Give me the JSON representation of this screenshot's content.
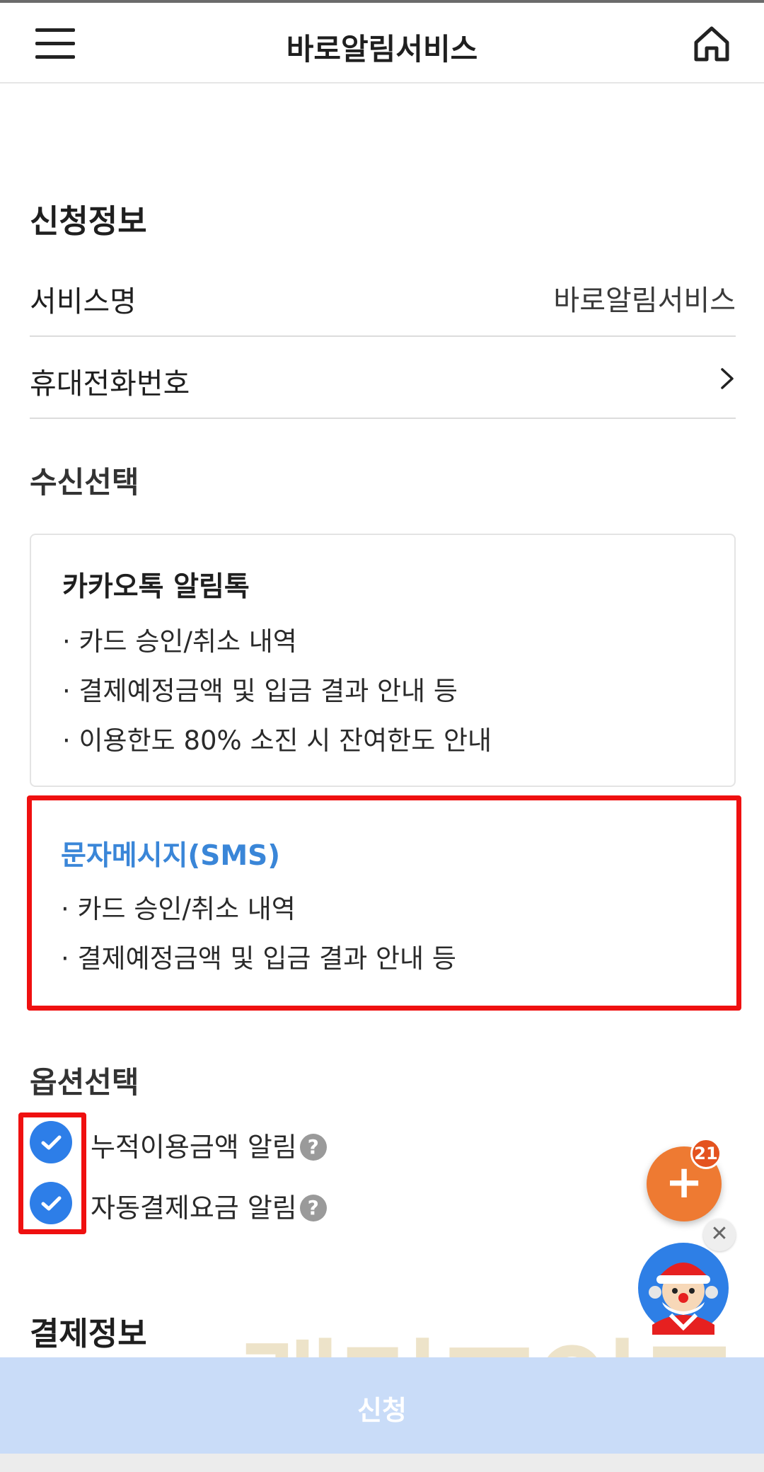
{
  "header": {
    "title": "바로알림서비스"
  },
  "application_info": {
    "section_title": "신청정보",
    "service_name_label": "서비스명",
    "service_name_value": "바로알림서비스",
    "phone_label": "휴대전화번호"
  },
  "reception": {
    "section_title": "수신선택",
    "kakao": {
      "title": "카카오톡 알림톡",
      "items": [
        "· 카드 승인/취소 내역",
        "· 결제예정금액 및 입금 결과 안내 등",
        "· 이용한도 80% 소진 시 잔여한도 안내"
      ]
    },
    "sms": {
      "title": "문자메시지(SMS)",
      "items": [
        "· 카드 승인/취소 내역",
        "· 결제예정금액 및 입금 결과 안내 등"
      ]
    }
  },
  "options": {
    "section_title": "옵션선택",
    "items": [
      {
        "label": "누적이용금액 알림",
        "checked": true
      },
      {
        "label": "자동결제요금 알림",
        "checked": true
      }
    ],
    "help_glyph": "?"
  },
  "payment": {
    "section_title": "결제정보"
  },
  "fab": {
    "badge_count": "21",
    "plus_glyph": "+"
  },
  "close_glyph": "✕",
  "watermark": "랠리포인트",
  "submit": {
    "label": "신청"
  },
  "colors": {
    "accent_blue": "#2d7ee8",
    "sms_title_blue": "#3a86d8",
    "highlight_red": "#ef1010",
    "fab_orange": "#ee7a32",
    "submit_bar": "#c9dcf8"
  },
  "icons": {
    "menu": "hamburger-menu-icon",
    "home": "home-icon",
    "chevron": "chevron-right-icon",
    "check": "checkmark-icon",
    "help": "question-circle-icon",
    "close": "close-icon",
    "mascot": "santa-mascot-icon"
  }
}
